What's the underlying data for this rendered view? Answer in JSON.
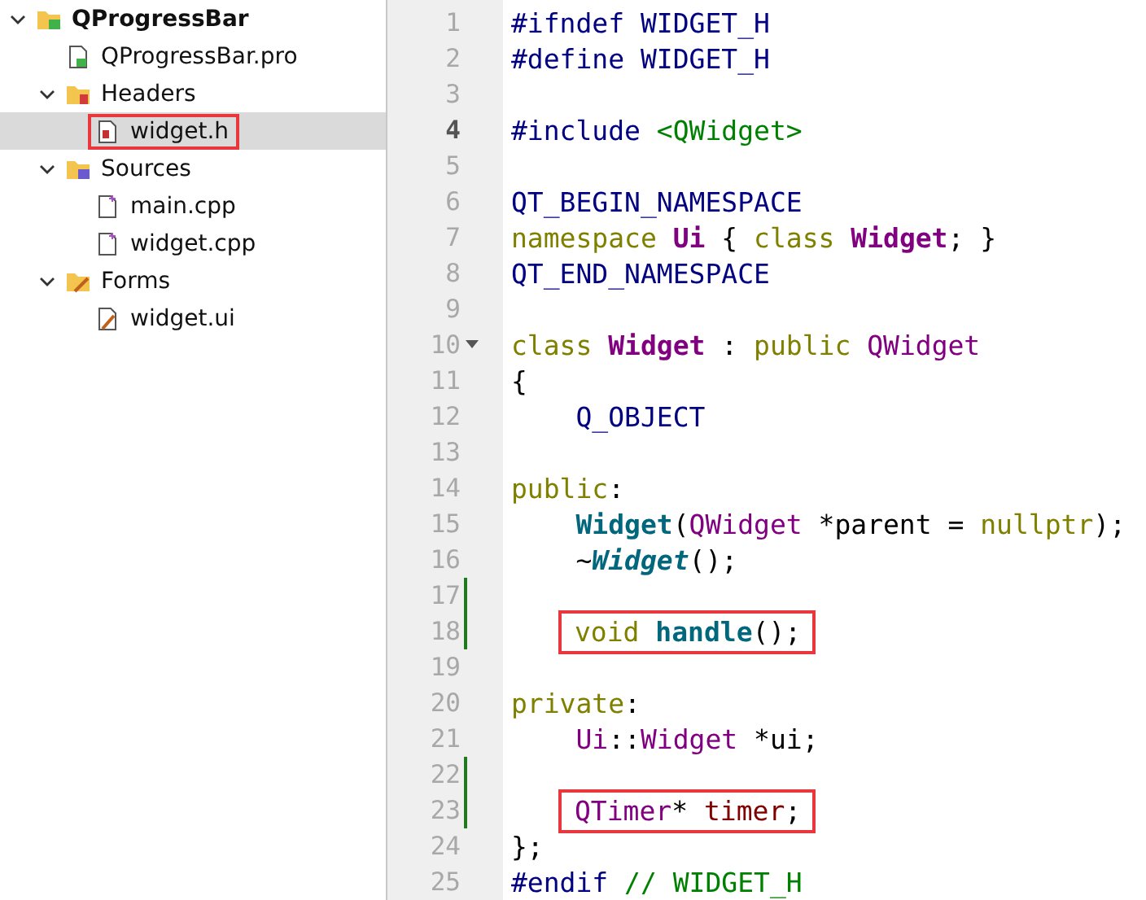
{
  "project_tree": [
    {
      "label": "QProgressBar",
      "kind": "qt-project",
      "expanded": true,
      "bold": true,
      "selected": false,
      "highlighted": false,
      "children": [
        {
          "label": "QProgressBar.pro",
          "kind": "pro-file",
          "selected": false,
          "highlighted": false
        },
        {
          "label": "Headers",
          "kind": "header-folder",
          "expanded": true,
          "selected": false,
          "highlighted": false,
          "children": [
            {
              "label": "widget.h",
              "kind": "header-file",
              "selected": true,
              "highlighted": true
            }
          ]
        },
        {
          "label": "Sources",
          "kind": "source-folder",
          "expanded": true,
          "selected": false,
          "highlighted": false,
          "children": [
            {
              "label": "main.cpp",
              "kind": "cpp-file",
              "selected": false,
              "highlighted": false
            },
            {
              "label": "widget.cpp",
              "kind": "cpp-file",
              "selected": false,
              "highlighted": false
            }
          ]
        },
        {
          "label": "Forms",
          "kind": "form-folder",
          "expanded": true,
          "selected": false,
          "highlighted": false,
          "children": [
            {
              "label": "widget.ui",
              "kind": "ui-file",
              "selected": false,
              "highlighted": false
            }
          ]
        }
      ]
    }
  ],
  "editor": {
    "lines": [
      {
        "number": "1",
        "current": false,
        "changed": false,
        "fold": false,
        "highlighted": false,
        "tokens": [
          {
            "text": "#ifndef ",
            "kind": "macro"
          },
          {
            "text": "WIDGET_H",
            "kind": "macro"
          }
        ]
      },
      {
        "number": "2",
        "current": false,
        "changed": false,
        "fold": false,
        "highlighted": false,
        "tokens": [
          {
            "text": "#define ",
            "kind": "macro"
          },
          {
            "text": "WIDGET_H",
            "kind": "macro"
          }
        ]
      },
      {
        "number": "3",
        "current": false,
        "changed": false,
        "fold": false
      },
      {
        "number": "4",
        "current": true,
        "changed": false,
        "fold": false,
        "highlighted": false,
        "tokens": [
          {
            "text": "#include ",
            "kind": "macro"
          },
          {
            "text": "<QWidget>",
            "kind": "string"
          }
        ]
      },
      {
        "number": "5",
        "current": false,
        "changed": false,
        "fold": false
      },
      {
        "number": "6",
        "current": false,
        "changed": false,
        "fold": false,
        "highlighted": false,
        "tokens": [
          {
            "text": "QT_BEGIN_NAMESPACE",
            "kind": "macro"
          }
        ]
      },
      {
        "number": "7",
        "current": false,
        "changed": false,
        "fold": false,
        "highlighted": false,
        "tokens": [
          {
            "text": "namespace ",
            "kind": "keyword"
          },
          {
            "text": "Ui",
            "kind": "type_bold"
          },
          {
            "text": " { ",
            "kind": "plain"
          },
          {
            "text": "class ",
            "kind": "keyword"
          },
          {
            "text": "Widget",
            "kind": "type_bold"
          },
          {
            "text": "; }",
            "kind": "plain"
          }
        ]
      },
      {
        "number": "8",
        "current": false,
        "changed": false,
        "fold": false,
        "highlighted": false,
        "tokens": [
          {
            "text": "QT_END_NAMESPACE",
            "kind": "macro"
          }
        ]
      },
      {
        "number": "9",
        "current": false,
        "changed": false,
        "fold": false
      },
      {
        "number": "10",
        "current": false,
        "changed": false,
        "fold": true,
        "highlighted": false,
        "tokens": [
          {
            "text": "class ",
            "kind": "keyword"
          },
          {
            "text": "Widget",
            "kind": "type_bold"
          },
          {
            "text": " : ",
            "kind": "plain"
          },
          {
            "text": "public ",
            "kind": "keyword"
          },
          {
            "text": "QWidget",
            "kind": "type"
          }
        ]
      },
      {
        "number": "11",
        "current": false,
        "changed": false,
        "fold": false,
        "highlighted": false,
        "tokens": [
          {
            "text": "{",
            "kind": "plain"
          }
        ]
      },
      {
        "number": "12",
        "current": false,
        "changed": false,
        "fold": false,
        "highlighted": false,
        "tokens": [
          {
            "text": "    Q_OBJECT",
            "kind": "macro"
          }
        ]
      },
      {
        "number": "13",
        "current": false,
        "changed": false,
        "fold": false
      },
      {
        "number": "14",
        "current": false,
        "changed": false,
        "fold": false,
        "highlighted": false,
        "tokens": [
          {
            "text": "public",
            "kind": "keyword"
          },
          {
            "text": ":",
            "kind": "plain"
          }
        ]
      },
      {
        "number": "15",
        "current": false,
        "changed": false,
        "fold": false,
        "highlighted": false,
        "tokens": [
          {
            "text": "    Widget",
            "kind": "func"
          },
          {
            "text": "(",
            "kind": "plain"
          },
          {
            "text": "QWidget",
            "kind": "type"
          },
          {
            "text": " *parent = ",
            "kind": "plain"
          },
          {
            "text": "nullptr",
            "kind": "keyword"
          },
          {
            "text": ");",
            "kind": "plain"
          }
        ]
      },
      {
        "number": "16",
        "current": false,
        "changed": false,
        "fold": false,
        "highlighted": false,
        "tokens": [
          {
            "text": "    ~",
            "kind": "plain"
          },
          {
            "text": "Widget",
            "kind": "func_italic"
          },
          {
            "text": "();",
            "kind": "plain"
          }
        ]
      },
      {
        "number": "17",
        "current": false,
        "changed": true,
        "fold": false
      },
      {
        "number": "18",
        "current": false,
        "changed": true,
        "fold": false,
        "highlighted": true,
        "tokens": [
          {
            "text": "void ",
            "kind": "keyword"
          },
          {
            "text": "handle",
            "kind": "func"
          },
          {
            "text": "();",
            "kind": "plain"
          }
        ]
      },
      {
        "number": "19",
        "current": false,
        "changed": false,
        "fold": false
      },
      {
        "number": "20",
        "current": false,
        "changed": false,
        "fold": false,
        "highlighted": false,
        "tokens": [
          {
            "text": "private",
            "kind": "keyword"
          },
          {
            "text": ":",
            "kind": "plain"
          }
        ]
      },
      {
        "number": "21",
        "current": false,
        "changed": false,
        "fold": false,
        "highlighted": false,
        "tokens": [
          {
            "text": "    Ui",
            "kind": "type"
          },
          {
            "text": "::",
            "kind": "plain"
          },
          {
            "text": "Widget",
            "kind": "type"
          },
          {
            "text": " *ui;",
            "kind": "plain"
          }
        ]
      },
      {
        "number": "22",
        "current": false,
        "changed": true,
        "fold": false
      },
      {
        "number": "23",
        "current": false,
        "changed": true,
        "fold": false,
        "highlighted": true,
        "tokens": [
          {
            "text": "QTimer",
            "kind": "type"
          },
          {
            "text": "* ",
            "kind": "plain"
          },
          {
            "text": "timer",
            "kind": "member"
          },
          {
            "text": ";",
            "kind": "plain"
          }
        ]
      },
      {
        "number": "24",
        "current": false,
        "changed": false,
        "fold": false,
        "highlighted": false,
        "tokens": [
          {
            "text": "};",
            "kind": "plain"
          }
        ]
      },
      {
        "number": "25",
        "current": false,
        "changed": false,
        "fold": false,
        "highlighted": false,
        "tokens": [
          {
            "text": "#endif ",
            "kind": "macro"
          },
          {
            "text": "// WIDGET_H",
            "kind": "comment"
          }
        ]
      }
    ]
  }
}
